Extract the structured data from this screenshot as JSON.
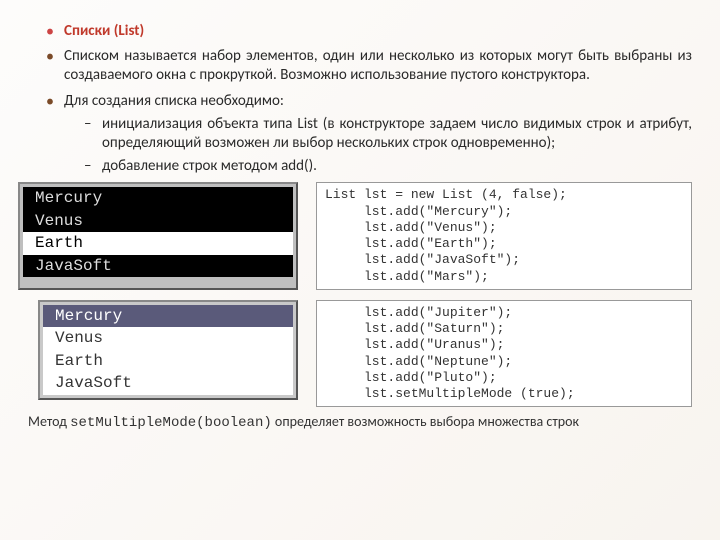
{
  "bullets": {
    "b1_title": "Списки (",
    "b1_paren": "List)",
    "b2": "Списком называется набор элементов, один или несколько из которых могут быть выбраны из создаваемого окна с прокруткой. Возможно использование пустого конструктора.",
    "b3": "Для создания списка необходимо:",
    "sub1": "инициализация объекта типа List (в конструкторе задаем число видимых строк и атрибут, определяющий возможен ли выбор нескольких строк одновременно);",
    "sub2": "добавление строк методом add()."
  },
  "listbox1": {
    "items": [
      "Mercury",
      "Venus",
      "Earth",
      "JavaSoft"
    ],
    "selected_index": 2
  },
  "listbox2": {
    "items": [
      "Mercury",
      "Venus",
      "Earth",
      "JavaSoft"
    ],
    "selected_index": 0
  },
  "code1": "List lst = new List (4, false);\n     lst.add(\"Mercury\");\n     lst.add(\"Venus\");\n     lst.add(\"Earth\");\n     lst.add(\"JavaSoft\");\n     lst.add(\"Mars\");",
  "code2": "     lst.add(\"Jupiter\");\n     lst.add(\"Saturn\");\n     lst.add(\"Uranus\");\n     lst.add(\"Neptune\");\n     lst.add(\"Pluto\");\n     lst.setMultipleMode (true);",
  "footnote": {
    "prefix": "Метод ",
    "code": "setMultipleMode(boolean)",
    "suffix": "  определяет возможность выбора множества строк"
  }
}
